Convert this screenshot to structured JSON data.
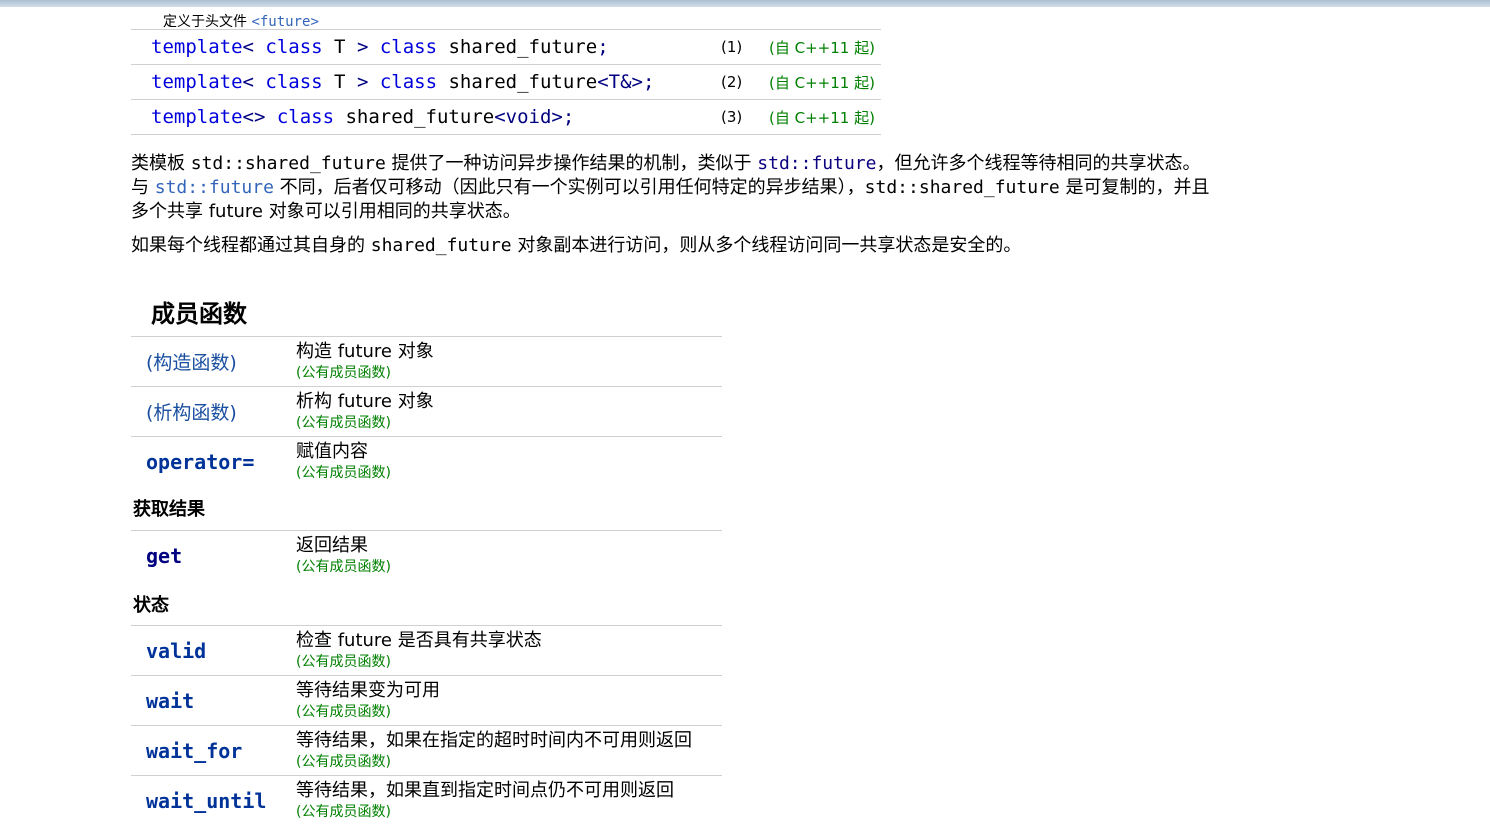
{
  "header": {
    "defined_in": "定义于头文件",
    "header_file": "<future>"
  },
  "declarations": [
    {
      "parts": [
        "template",
        "< ",
        "class",
        " T ",
        ">",
        " class",
        " shared_future",
        ";"
      ],
      "num": "(1)",
      "since": "(自 C++11 起)"
    },
    {
      "parts": [
        "template",
        "< ",
        "class",
        " T ",
        ">",
        " class",
        " shared_future",
        "<T&>;"
      ],
      "num": "(2)",
      "since": "(自 C++11 起)"
    },
    {
      "parts": [
        "template",
        "<>",
        " class",
        " shared_future",
        "<void>;"
      ],
      "num": "(3)",
      "since": "(自 C++11 起)"
    }
  ],
  "description": {
    "p1_l1_a": "类模板 ",
    "p1_l1_code": "std::shared_future",
    "p1_l1_b": " 提供了一种访问异步操作结果的机制，类似于 ",
    "p1_l1_link": "std::future",
    "p1_l1_c": "，但允许多个线程等待相同的共享状态。",
    "p1_l2_a": "与 ",
    "p1_l2_link": "std::future",
    "p1_l2_b": " 不同，后者仅可移动（因此只有一个实例可以引用任何特定的异步结果），",
    "p1_l2_code": "std::shared_future",
    "p1_l2_c": " 是可复制的，并且",
    "p1_l3": "多个共享 future 对象可以引用相同的共享状态。",
    "p2_a": "如果每个线程都通过其自身的 ",
    "p2_code": "shared_future",
    "p2_b": " 对象副本进行访问，则从多个线程访问同一共享状态是安全的。"
  },
  "section_title": "成员函数",
  "tag_public": "(公有成员函数)",
  "members_group1": [
    {
      "name": "(构造函数)",
      "desc": "构造 future 对象"
    },
    {
      "name": "(析构函数)",
      "desc": "析构 future 对象"
    },
    {
      "name": "operator=",
      "desc": "赋值内容"
    }
  ],
  "group_get_title": "获取结果",
  "members_group2": [
    {
      "name": "get",
      "desc": "返回结果"
    }
  ],
  "group_state_title": "状态",
  "members_group3": [
    {
      "name": "valid",
      "desc": "检查 future 是否具有共享状态"
    },
    {
      "name": "wait",
      "desc": "等待结果变为可用"
    },
    {
      "name": "wait_for",
      "desc": "等待结果，如果在指定的超时时间内不可用则返回"
    },
    {
      "name": "wait_until",
      "desc": "等待结果，如果直到指定时间点仍不可用则返回"
    }
  ]
}
